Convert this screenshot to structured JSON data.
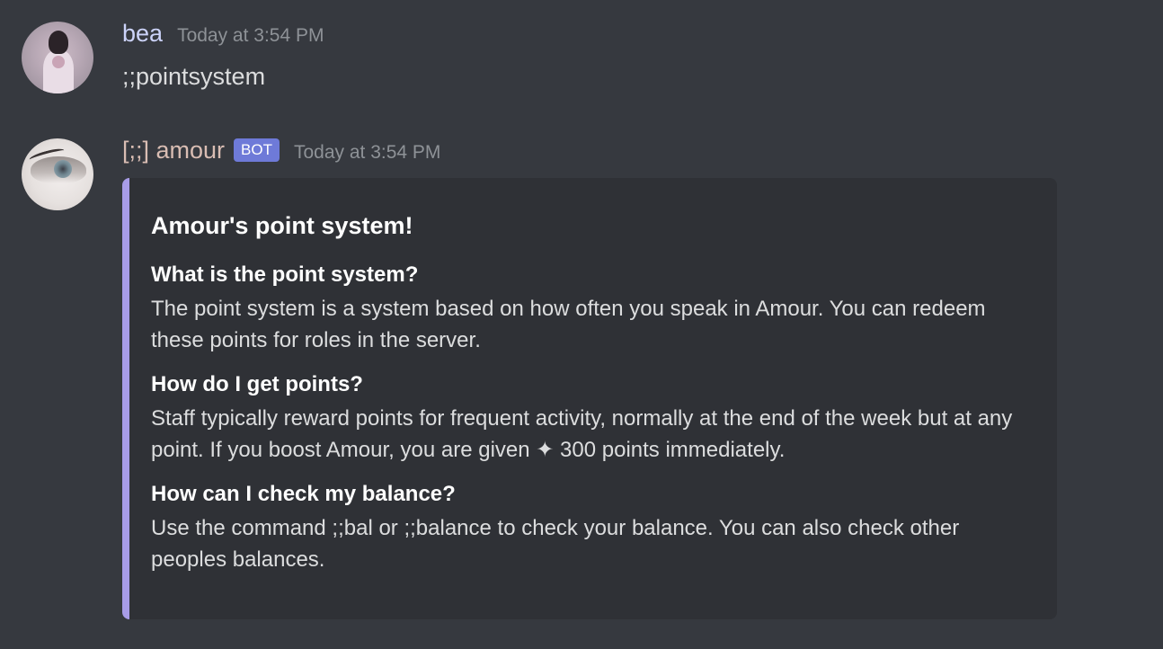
{
  "messages": [
    {
      "author": "bea",
      "timestamp": "Today at 3:54 PM",
      "content": ";;pointsystem"
    },
    {
      "author": "[;;] amour",
      "badge": "BOT",
      "timestamp": "Today at 3:54 PM",
      "embed": {
        "title": "Amour's point system!",
        "accent_color": "#a89ce8",
        "fields": [
          {
            "name": "What is the point system?",
            "value": "The point system is a system based on how often you speak in Amour. You can redeem these points for roles in the server."
          },
          {
            "name": "How do I get points?",
            "value": "Staff typically reward points for frequent activity, normally at the end of the week but at any point. If you boost Amour, you are given ✦ 300 points immediately."
          },
          {
            "name": "How can I check my balance?",
            "value": "Use the command ;;bal or ;;balance to check your balance. You can also check other peoples balances."
          }
        ]
      }
    }
  ],
  "colors": {
    "background": "#36393f",
    "embed_background": "#2f3136",
    "bot_badge": "#6e7ad8",
    "user_name": "#ccd3f9",
    "bot_name": "#d9bdb3",
    "timestamp": "#8e9297"
  }
}
